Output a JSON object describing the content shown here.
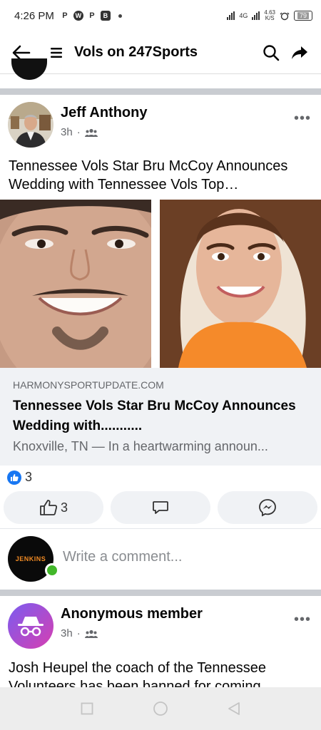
{
  "status_bar": {
    "time": "4:26 PM",
    "network": "4G",
    "speed_value": "4.63",
    "speed_unit": "K/S",
    "battery": "79"
  },
  "header": {
    "title": "Vols on 247Sports"
  },
  "post1": {
    "author": "Jeff Anthony",
    "time": "3h",
    "text": "Tennessee Vols Star Bru McCoy Announces Wedding with Tennessee Vols Top…",
    "link": {
      "domain": "HARMONYSPORTUPDATE.COM",
      "title": "Tennessee Vols Star Bru McCoy Announces Wedding with...........",
      "description": "Knoxville, TN — In a heartwarming announ..."
    },
    "reaction_count": "3",
    "like_count": "3"
  },
  "comment": {
    "avatar_text": "JENKINS",
    "placeholder": "Write a comment..."
  },
  "post2": {
    "author": "Anonymous member",
    "time": "3h",
    "text": "Josh Heupel the coach of the Tennessee Volunteers has been banned for coming"
  },
  "colors": {
    "accent": "#1877f2",
    "online": "#42b72a",
    "muted": "#65676b"
  }
}
